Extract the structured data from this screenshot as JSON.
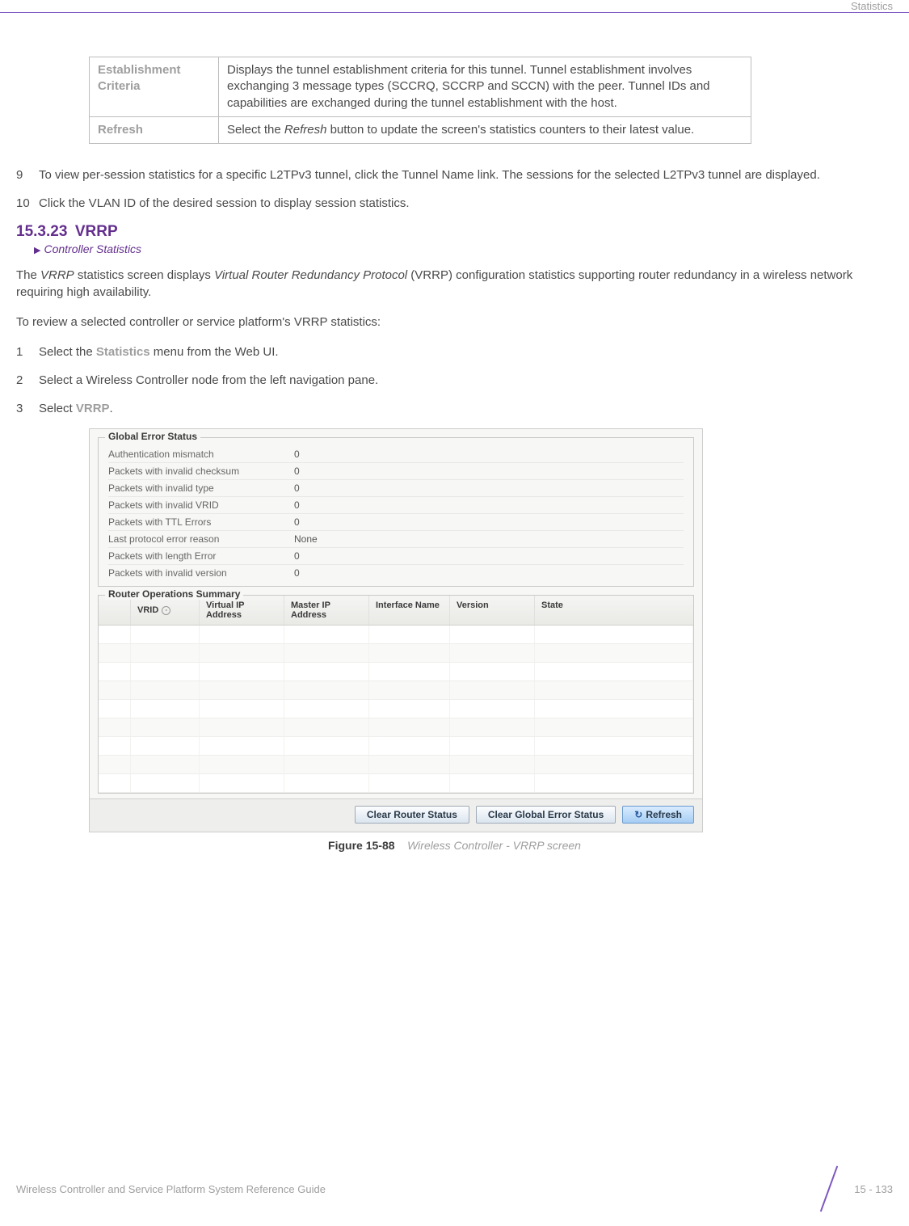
{
  "header": {
    "section": "Statistics"
  },
  "table": {
    "rows": [
      {
        "label": "Establishment Criteria",
        "desc": "Displays the tunnel establishment criteria for this tunnel. Tunnel establishment involves exchanging 3 message types (SCCRQ, SCCRP and SCCN) with the peer. Tunnel IDs and capabilities are exchanged during the tunnel establishment with the host."
      },
      {
        "label": "Refresh",
        "desc_pre": "Select the ",
        "desc_em": "Refresh",
        "desc_post": " button to update the screen's statistics counters to their latest value."
      }
    ]
  },
  "steps_a": [
    {
      "n": "9",
      "t": "To view per-session statistics for a specific L2TPv3 tunnel, click the Tunnel Name link. The sessions for the selected L2TPv3 tunnel are displayed."
    },
    {
      "n": "10",
      "t": "Click the VLAN ID of the desired session to display session statistics."
    }
  ],
  "section": {
    "num": "15.3.23",
    "title": "VRRP",
    "breadcrumb": "Controller Statistics"
  },
  "paras": {
    "p1_pre": "The ",
    "p1_em1": "VRRP",
    "p1_mid1": " statistics screen displays ",
    "p1_em2": "Virtual Router Redundancy Protocol",
    "p1_post": " (VRRP) configuration statistics supporting router redundancy in a wireless network requiring high availability.",
    "p2": "To review a selected controller or service platform's VRRP statistics:"
  },
  "steps_b": [
    {
      "n": "1",
      "pre": "Select the ",
      "bold": "Statistics",
      "post": " menu from the Web UI."
    },
    {
      "n": "2",
      "t": "Select a Wireless Controller node from the left navigation pane."
    },
    {
      "n": "3",
      "pre": "Select ",
      "bold": "VRRP",
      "post": "."
    }
  ],
  "vrrp": {
    "global_legend": "Global Error Status",
    "global_rows": [
      {
        "k": "Authentication mismatch",
        "v": "0"
      },
      {
        "k": "Packets with invalid checksum",
        "v": "0"
      },
      {
        "k": "Packets with invalid type",
        "v": "0"
      },
      {
        "k": "Packets with invalid VRID",
        "v": "0"
      },
      {
        "k": "Packets with TTL Errors",
        "v": "0"
      },
      {
        "k": "Last protocol error reason",
        "v": "None"
      },
      {
        "k": "Packets with length Error",
        "v": "0"
      },
      {
        "k": "Packets with invalid version",
        "v": "0"
      }
    ],
    "router_legend": "Router Operations Summary",
    "cols": [
      "",
      "VRID",
      "Virtual IP Address",
      "Master IP Address",
      "Interface Name",
      "Version",
      "State"
    ],
    "buttons": {
      "clear_router": "Clear Router Status",
      "clear_global": "Clear Global Error Status",
      "refresh": "Refresh"
    }
  },
  "figure": {
    "label": "Figure 15-88",
    "caption": "Wireless Controller - VRRP screen"
  },
  "footer": {
    "left": "Wireless Controller and Service Platform System Reference Guide",
    "page": "15 - 133"
  }
}
